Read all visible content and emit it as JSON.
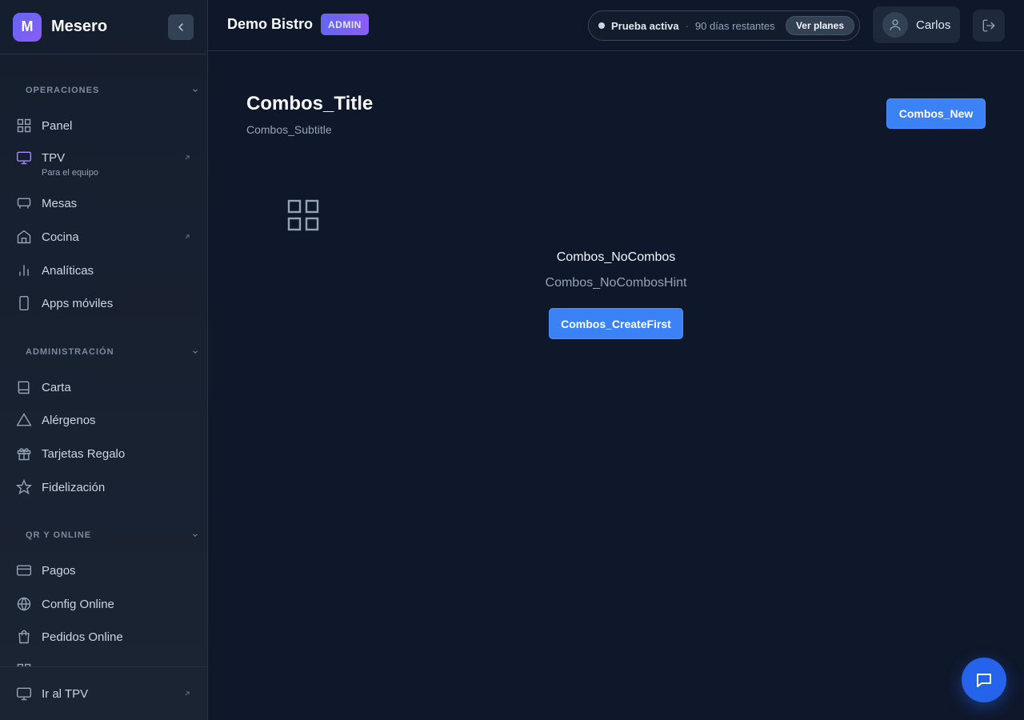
{
  "app": {
    "logo_letter": "M",
    "name": "Mesero"
  },
  "sidebar": {
    "sections": [
      {
        "title": "OPERACIONES",
        "items": [
          {
            "label": "Panel",
            "icon": "grid-icon"
          },
          {
            "label": "TPV",
            "sub": "Para el equipo",
            "icon": "monitor-icon",
            "external": true
          },
          {
            "label": "Mesas",
            "icon": "table-icon"
          },
          {
            "label": "Cocina",
            "icon": "home-icon",
            "external": true
          },
          {
            "label": "Analíticas",
            "icon": "bar-chart-icon"
          },
          {
            "label": "Apps móviles",
            "icon": "smartphone-icon"
          }
        ]
      },
      {
        "title": "ADMINISTRACIÓN",
        "items": [
          {
            "label": "Carta",
            "icon": "book-icon"
          },
          {
            "label": "Alérgenos",
            "icon": "warning-icon"
          },
          {
            "label": "Tarjetas Regalo",
            "icon": "gift-icon"
          },
          {
            "label": "Fidelización",
            "icon": "star-icon"
          }
        ]
      },
      {
        "title": "QR Y ONLINE",
        "items": [
          {
            "label": "Pagos",
            "icon": "credit-card-icon"
          },
          {
            "label": "Config Online",
            "icon": "globe-icon"
          },
          {
            "label": "Pedidos Online",
            "icon": "shopping-bag-icon"
          }
        ]
      }
    ],
    "footer": {
      "label": "Ir al TPV",
      "icon": "monitor-icon"
    }
  },
  "topbar": {
    "venue": "Demo Bistro",
    "role_badge": "ADMIN",
    "trial": {
      "status": "Prueba activa",
      "separator": "·",
      "days_left": "90 días restantes",
      "plans_button": "Ver planes"
    },
    "user": {
      "name": "Carlos"
    }
  },
  "main": {
    "title": "Combos_Title",
    "subtitle": "Combos_Subtitle",
    "new_button": "Combos_New",
    "empty": {
      "title": "Combos_NoCombos",
      "hint": "Combos_NoCombosHint",
      "cta": "Combos_CreateFirst"
    }
  },
  "colors": {
    "accent": "#3b82f6",
    "brand": "#6366f1",
    "background": "#0f172a"
  }
}
